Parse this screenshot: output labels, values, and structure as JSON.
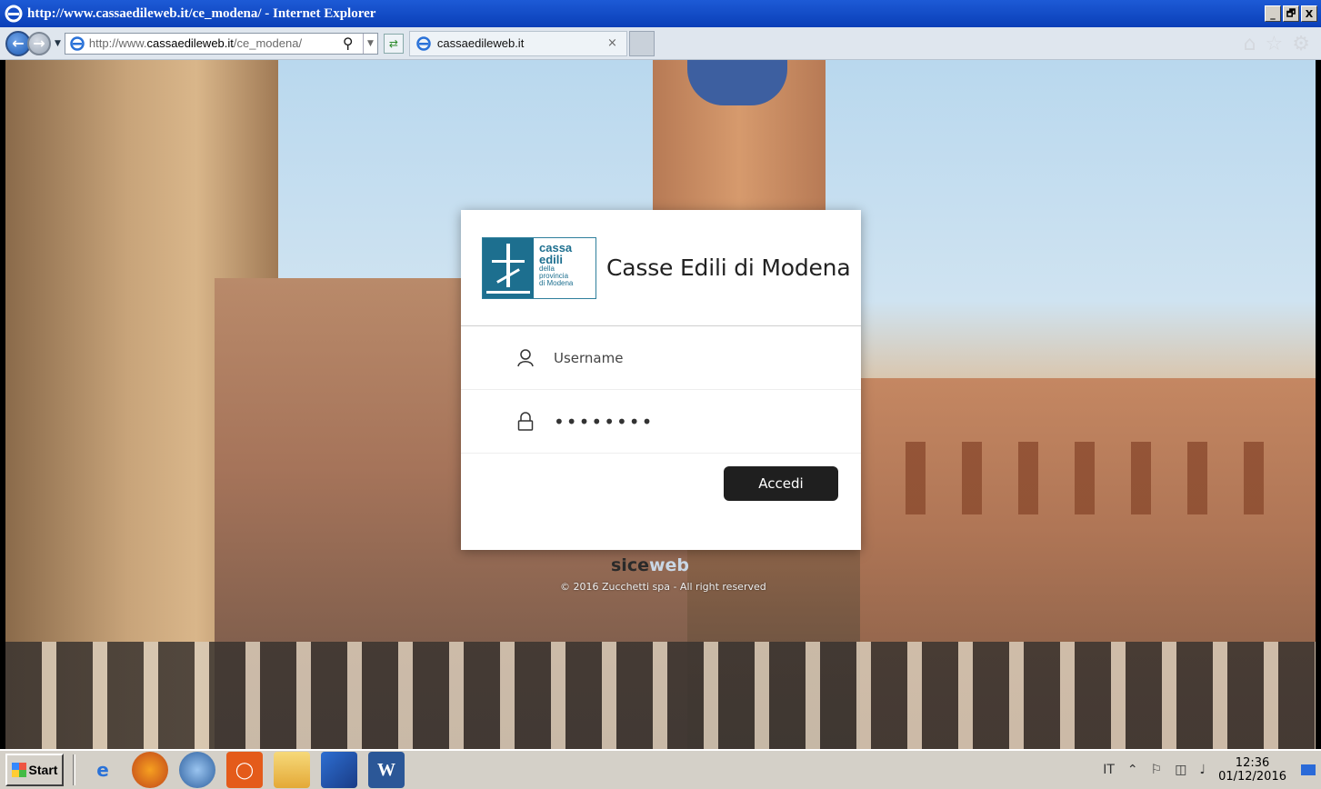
{
  "window": {
    "title": "http://www.cassaedileweb.it/ce_modena/ - Internet Explorer",
    "min_label": "_",
    "max_label": "🗗",
    "close_label": "X"
  },
  "browser": {
    "address_prefix": "http://www.",
    "address_host": "cassaedileweb.it",
    "address_path": "/ce_modena/",
    "tab_title": "cassaedileweb.it",
    "tab_close": "×"
  },
  "login": {
    "logo_big_1": "cassa",
    "logo_big_2": "edili",
    "logo_small_1": "della",
    "logo_small_2": "provincia",
    "logo_small_3": "di Modena",
    "title": "Casse Edili di Modena",
    "username_placeholder": "Username",
    "password_value": "••••••••",
    "submit_label": "Accedi"
  },
  "footer": {
    "brand_part1": "sice",
    "brand_part2": "web",
    "copyright": "© 2016 Zucchetti spa - All right reserved"
  },
  "taskbar": {
    "start_label": "Start",
    "lang": "IT",
    "tray_up": "⌃",
    "time": "12:36",
    "date": "01/12/2016"
  },
  "colors": {
    "ie_blue": "#1d5ad6",
    "button_dark": "#1f1f1f",
    "logo_teal": "#1d6f8f"
  }
}
